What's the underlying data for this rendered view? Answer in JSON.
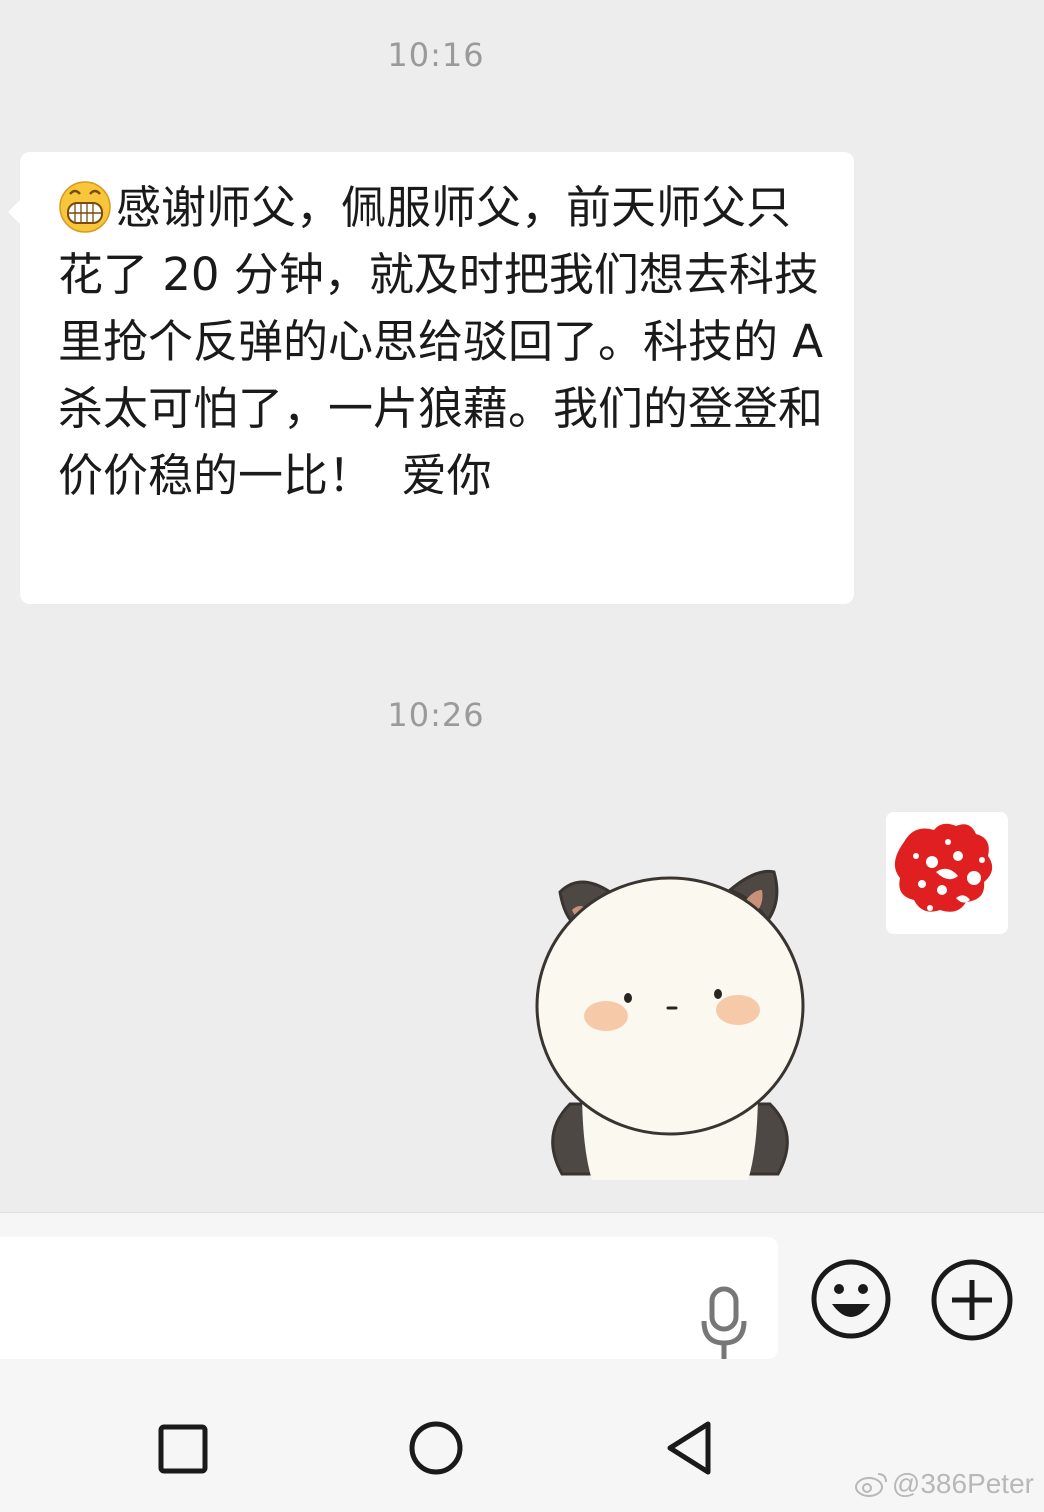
{
  "chat": {
    "timestamp_1": "10:16",
    "message_1": {
      "emoji": "grinning-face-emoji",
      "text": "感谢师父，佩服师父，前天师父只花了 20 分钟，就及时把我们想去科技里抢个反弹的心思给驳回了。科技的 A 杀太可怕了，一片狼藉。我们的登登和价价稳的一比！  爱你"
    },
    "timestamp_2": "10:26",
    "sender_avatar": "red-papercut-avatar",
    "sticker": "panda-sticker"
  },
  "input_bar": {
    "mic_icon": "microphone-icon",
    "emoji_icon": "smiley-icon",
    "plus_icon": "plus-circle-icon"
  },
  "navbar": {
    "recent_icon": "square-recent-icon",
    "home_icon": "circle-home-icon",
    "back_icon": "triangle-back-icon"
  },
  "watermark": {
    "text": "@386Peter"
  },
  "colors": {
    "chat_background": "#ededed",
    "bubble_background": "#ffffff",
    "timestamp_text": "#9a9a9a",
    "avatar_red": "#e02020"
  }
}
